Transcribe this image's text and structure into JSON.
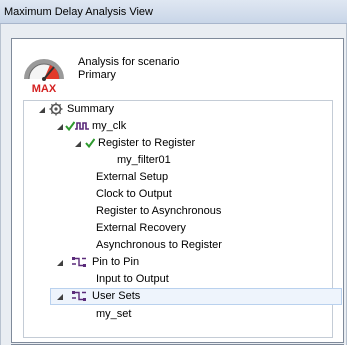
{
  "window": {
    "title": "Maximum Delay Analysis View"
  },
  "scenario": {
    "icon": "max-gauge-icon",
    "badge": "MAX",
    "line1": "Analysis for scenario",
    "line2": "Primary"
  },
  "tree": {
    "summary": "Summary",
    "clock": "my_clk",
    "reg_to_reg": "Register to Register",
    "filter": "my_filter01",
    "external_setup": "External Setup",
    "clock_to_output": "Clock to Output",
    "reg_to_async": "Register to Asynchronous",
    "external_recovery": "External Recovery",
    "async_to_reg": "Asynchronous to Register",
    "pin_to_pin": "Pin to Pin",
    "input_to_output": "Input to Output",
    "user_sets": "User Sets",
    "my_set": "my_set"
  },
  "colors": {
    "check": "#2e9a2e",
    "gauge_red": "#d42020",
    "path_icon": "#5a2a7a",
    "selection": "#eef4fc"
  }
}
